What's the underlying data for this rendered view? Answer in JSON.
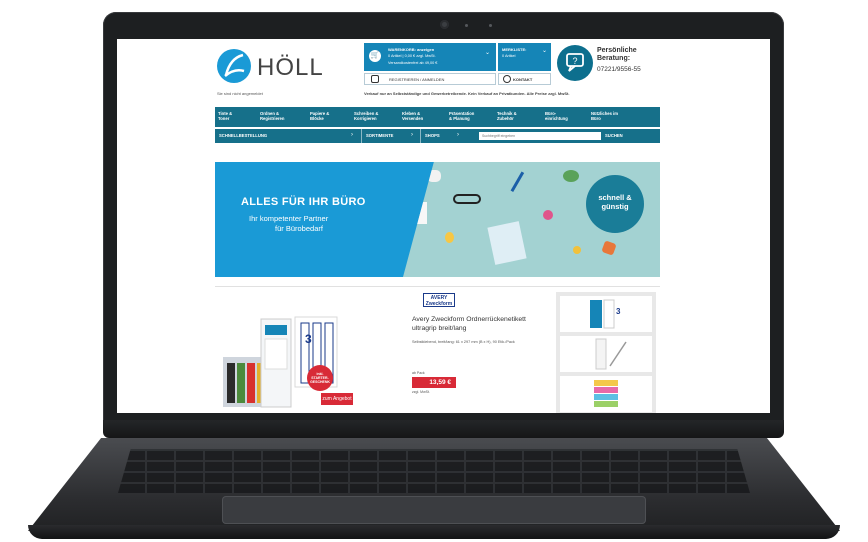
{
  "header": {
    "brand": "HÖLL",
    "not_logged_in": "Sie sind nicht angemeldet",
    "cart": {
      "title": "WARENKORB: anzeigen",
      "items_line": "0 Artikel | 0,00 € zzgl. MwSt.",
      "shipping_line": "Versandkostenfrei ab 49,00 €"
    },
    "memo": {
      "title": "MERKLISTE:",
      "items": "0 Artikel"
    },
    "register_label": "REGISTRIEREN / ANMELDEN",
    "contact_label": "KONTAKT",
    "advice": {
      "title": "Persönliche Beratung:",
      "phone": "07221/9556-55"
    },
    "notice": "Verkauf nur an Selbstständige und Gewerbetreibende. Kein Verkauf an Privatkunden. Alle Preise zzgl. MwSt."
  },
  "nav": {
    "items": [
      {
        "line1": "Tinte &",
        "line2": "Toner"
      },
      {
        "line1": "Ordnen &",
        "line2": "Registrieren"
      },
      {
        "line1": "Papiere &",
        "line2": "Blöcke"
      },
      {
        "line1": "Schreiben &",
        "line2": "Korrigieren"
      },
      {
        "line1": "Kleben &",
        "line2": "Versenden"
      },
      {
        "line1": "Präsentation",
        "line2": "& Planung"
      },
      {
        "line1": "Technik &",
        "line2": "Zubehör"
      },
      {
        "line1": "Büro-",
        "line2": "einrichtung"
      },
      {
        "line1": "Nützliches im",
        "line2": "Büro"
      }
    ]
  },
  "subnav": {
    "quick_order": "SCHNELLBESTELLUNG",
    "assortments": "SORTIMENTE",
    "shops": "SHOPS",
    "search_placeholder": "Suchbegriff eingeben",
    "search_button": "SUCHEN"
  },
  "banner": {
    "headline": "ALLES FÜR IHR BÜRO",
    "sub1": "Ihr kompetenter Partner",
    "sub2": "für Bürobedarf",
    "badge_line1": "schnell &",
    "badge_line2": "günstig"
  },
  "product": {
    "brand_line1": "AVERY",
    "brand_line2": "Zweckform",
    "name": "Avery Zweckform Ordnerrückenetikett ultragrip breit/lang",
    "desc": "Selbstklebend, breit/lang: 61 x 297 mm (B x H), 90 Etik./Pack",
    "price_label": "ab Pack",
    "price": "13,59 €",
    "vat": "zzgl. MwSt.",
    "badge_line1": "inkl.",
    "badge_line2": "STARTER-",
    "badge_line3": "GESCHENK",
    "offer_button": "zum Angebot"
  },
  "colors": {
    "brand_blue": "#1a9ad6",
    "nav_teal": "#16708a",
    "accent_red": "#d82a37"
  }
}
